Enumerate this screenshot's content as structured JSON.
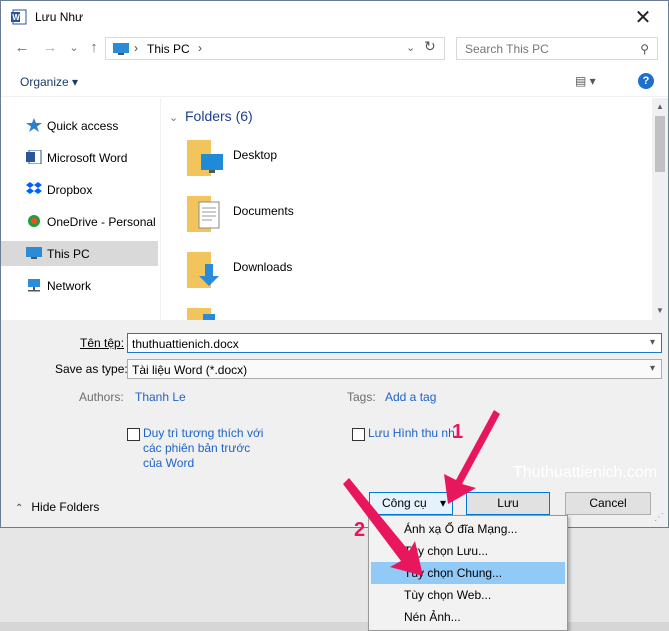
{
  "window": {
    "title": "Lưu Như",
    "close_glyph": "✕"
  },
  "nav": {
    "back_glyph": "←",
    "forward_glyph": "→",
    "recent_glyph": "⌄",
    "up_glyph": "↑",
    "address_location": "This PC",
    "address_sep": "›",
    "address_dropdown": "⌄",
    "refresh_glyph": "↻",
    "search_placeholder": "Search This PC",
    "search_glyph": "⚲"
  },
  "toolbar": {
    "organize_label": "Organize ▾",
    "view_glyph": "▤ ▾",
    "help_label": "?"
  },
  "sidebar": {
    "items": [
      {
        "label": "Quick access",
        "icon": "star-icon"
      },
      {
        "label": "Microsoft Word",
        "icon": "word-icon"
      },
      {
        "label": "Dropbox",
        "icon": "dropbox-icon"
      },
      {
        "label": "OneDrive - Personal",
        "icon": "onedrive-icon"
      },
      {
        "label": "This PC",
        "icon": "pc-icon",
        "selected": true
      },
      {
        "label": "Network",
        "icon": "network-icon"
      }
    ]
  },
  "content": {
    "section_chevron": "⌄",
    "section_title": "Folders (6)",
    "folders": [
      {
        "name": "Desktop",
        "icon": "desktop-folder-icon"
      },
      {
        "name": "Documents",
        "icon": "documents-folder-icon"
      },
      {
        "name": "Downloads",
        "icon": "downloads-folder-icon"
      }
    ]
  },
  "form": {
    "filename_label": "Tên tệp:",
    "filename_value": "thuthuattienich.docx",
    "savetype_label": "Save as type:",
    "savetype_value": "Tài liệu Word (*.docx)",
    "authors_label": "Authors:",
    "authors_value": "Thanh Le",
    "tags_label": "Tags:",
    "tags_value": "Add a tag",
    "compat_label_1": "Duy trì tương thích với",
    "compat_label_2": "các phiên bản trước",
    "compat_label_3": "của Word",
    "thumb_label": "Lưu Hình thu nh",
    "dropdown_arrow": "▾"
  },
  "buttons": {
    "tools": "Công cụ",
    "tools_arrow": "▾",
    "save": "Lưu",
    "cancel": "Cancel",
    "hide_folders": "Hide Folders",
    "hide_chevron": "⌃"
  },
  "menu": {
    "items": [
      {
        "label": "Ánh xạ Ổ đĩa Mạng...",
        "highlighted": false
      },
      {
        "label": "Tùy chọn Lưu...",
        "highlighted": false
      },
      {
        "label": "Tùy chọn Chung...",
        "highlighted": true
      },
      {
        "label": "Tùy chọn Web...",
        "highlighted": false
      },
      {
        "label": "Nén Ảnh...",
        "highlighted": false
      }
    ]
  },
  "annotations": {
    "step1": "1",
    "step2": "2",
    "watermark": "Thuthuattienich.com",
    "color": "#e8175d"
  },
  "colors": {
    "selection": "#d9d9d9",
    "menu_highlight": "#91c9f7",
    "link": "#1f63c8",
    "section_title": "#1e3f8a",
    "focus_border": "#1979ca"
  }
}
